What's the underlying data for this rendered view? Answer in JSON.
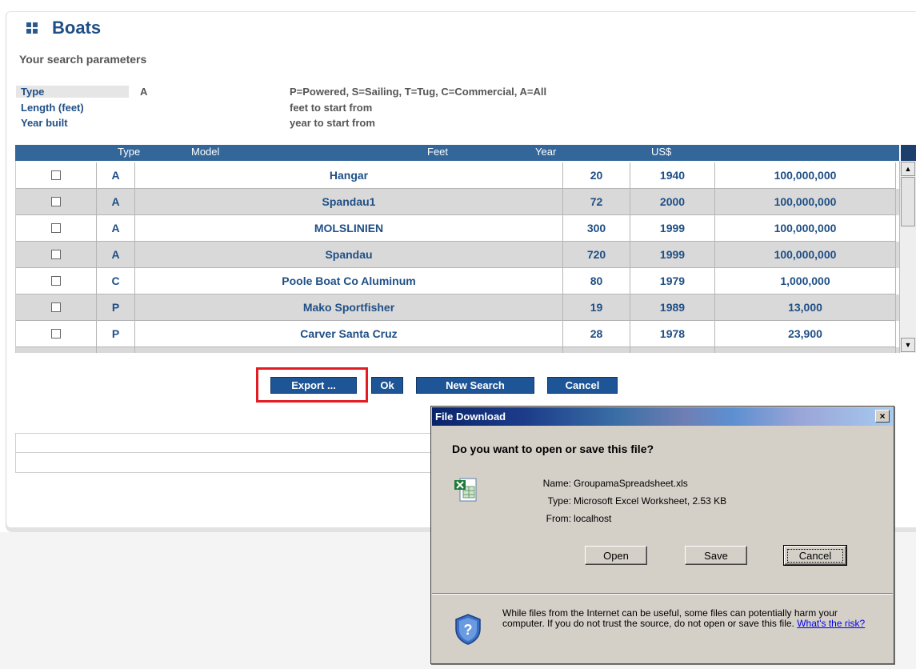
{
  "page": {
    "title": "Boats",
    "search_params_label": "Your search parameters"
  },
  "params": [
    {
      "label": "Type",
      "value": "A",
      "help": "P=Powered, S=Sailing, T=Tug, C=Commercial, A=All"
    },
    {
      "label": "Length (feet)",
      "value": "",
      "help": "feet to start from"
    },
    {
      "label": "Year built",
      "value": "",
      "help": "year to start from"
    }
  ],
  "grid": {
    "columns": [
      "Type",
      "Model",
      "Feet",
      "Year",
      "US$"
    ],
    "rows": [
      {
        "checked": false,
        "type": "A",
        "model": "Hangar",
        "feet": "20",
        "year": "1940",
        "price": "100,000,000"
      },
      {
        "checked": false,
        "type": "A",
        "model": "Spandau1",
        "feet": "72",
        "year": "2000",
        "price": "100,000,000"
      },
      {
        "checked": false,
        "type": "A",
        "model": "MOLSLINIEN",
        "feet": "300",
        "year": "1999",
        "price": "100,000,000"
      },
      {
        "checked": false,
        "type": "A",
        "model": "Spandau",
        "feet": "720",
        "year": "1999",
        "price": "100,000,000"
      },
      {
        "checked": false,
        "type": "C",
        "model": "Poole Boat Co Aluminum",
        "feet": "80",
        "year": "1979",
        "price": "1,000,000"
      },
      {
        "checked": false,
        "type": "P",
        "model": "Mako Sportfisher",
        "feet": "19",
        "year": "1989",
        "price": "13,000"
      },
      {
        "checked": false,
        "type": "P",
        "model": "Carver Santa Cruz",
        "feet": "28",
        "year": "1978",
        "price": "23,900"
      }
    ]
  },
  "actions": {
    "export_label": "Export ...",
    "ok_label": "Ok",
    "new_search_label": "New Search",
    "cancel_label": "Cancel"
  },
  "dialog": {
    "title": "File Download",
    "close_glyph": "×",
    "question": "Do you want to open or save this file?",
    "name_label": "Name:",
    "name_value": "GroupamaSpreadsheet.xls",
    "type_label": "Type:",
    "type_value": "Microsoft Excel Worksheet, 2.53 KB",
    "from_label": "From:",
    "from_value": "localhost",
    "open_label": "Open",
    "save_label": "Save",
    "cancel_label": "Cancel",
    "warning": "While files from the Internet can be useful, some files can potentially harm your computer. If you do not trust the source, do not open or save this file.",
    "risk_link": "What's the risk?"
  },
  "colors": {
    "brand_blue": "#1f4f86",
    "header_blue": "#336699",
    "button_blue": "#1e5596",
    "highlight_red": "#e31b23"
  }
}
